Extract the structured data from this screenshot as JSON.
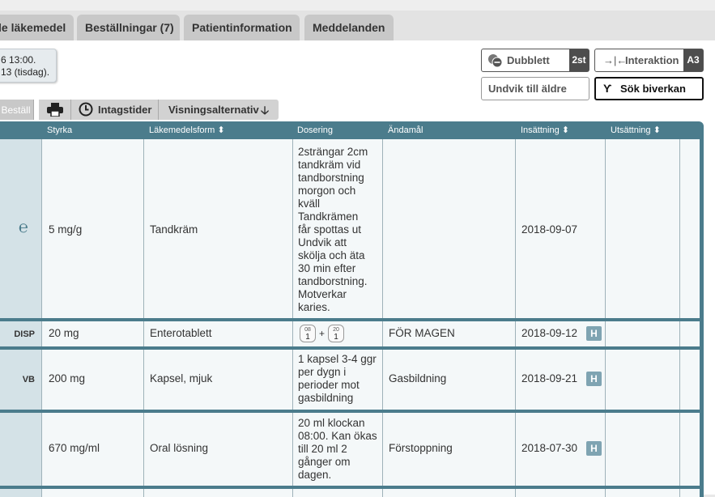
{
  "tabs": [
    {
      "label": "le läkemedel"
    },
    {
      "label": "Beställningar (7)"
    },
    {
      "label": "Patientinformation"
    },
    {
      "label": "Meddelanden"
    }
  ],
  "date_box": {
    "line1": "6 13:00.",
    "line2": "13 (tisdag)."
  },
  "buttons": {
    "dubblett": {
      "label": "Dubblett",
      "badge": "2st"
    },
    "interaktion": {
      "label": "Interaktion",
      "badge": "A3"
    },
    "undvik": {
      "label": "Undvik till äldre"
    },
    "biverkan": {
      "label": "Sök biverkan"
    }
  },
  "toolbar": {
    "bestall": "Beställ",
    "intagstider": "Intagstider",
    "visning": "Visningsalternativ"
  },
  "columns": {
    "styrka": "Styrka",
    "form": "Läkemedelsform",
    "dosering": "Dosering",
    "andamal": "Ändamål",
    "insattning": "Insättning",
    "utsattning": "Utsättning"
  },
  "rows": [
    {
      "code": "",
      "styrka": "5 mg/g",
      "form": "Tandkräm",
      "dosering": [
        "2strängar 2cm",
        "tandkräm vid",
        "tandborstning",
        "morgon och",
        "kväll",
        "Tandkrämen",
        "får spottas ut",
        "Undvik att",
        "skölja och äta",
        "30 min efter",
        "tandborstning.",
        "Motverkar",
        "karies."
      ],
      "andamal": "",
      "insattning": "2018-09-07",
      "badge": ""
    },
    {
      "code": "DISP",
      "styrka": "20 mg",
      "form": "Enterotablett",
      "dose_chips": [
        {
          "time": "08",
          "qty": "1"
        },
        {
          "time": "20",
          "qty": "1"
        }
      ],
      "plus": "+",
      "andamal": "FÖR MAGEN",
      "insattning": "2018-09-12",
      "badge": "H"
    },
    {
      "code": "VB",
      "styrka": "200 mg",
      "form": "Kapsel, mjuk",
      "dosering": [
        "1 kapsel 3-4 ggr",
        "per dygn i",
        "perioder mot",
        "gasbildning"
      ],
      "andamal": "Gasbildning",
      "insattning": "2018-09-21",
      "badge": "H"
    },
    {
      "code": "",
      "styrka": "670 mg/ml",
      "form": "Oral lösning",
      "dosering": [
        "20 ml klockan",
        "08:00. Kan ökas",
        "till 20 ml 2",
        "gånger om",
        "dagen."
      ],
      "andamal": "Förstoppning",
      "insattning": "2018-07-30",
      "badge": "H"
    }
  ],
  "colors": {
    "header": "#4b7c8c",
    "badge": "#7fa4b2",
    "row_bg": "#f4f8f9"
  }
}
